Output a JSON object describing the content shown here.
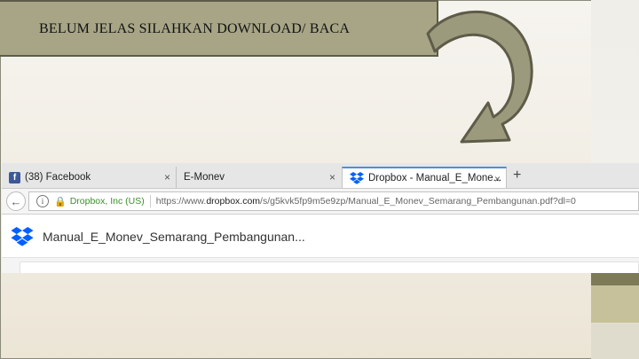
{
  "slide": {
    "title": "BELUM JELAS SILAHKAN DOWNLOAD/ BACA"
  },
  "browser": {
    "tabs": [
      {
        "label": "(38) Facebook",
        "icon": "facebook-icon"
      },
      {
        "label": "E-Monev",
        "icon": ""
      },
      {
        "label": "Dropbox - Manual_E_Mone...",
        "icon": "dropbox-icon",
        "active": true
      }
    ],
    "new_tab": "+",
    "close_glyph": "×",
    "address": {
      "identity": "Dropbox, Inc (US)",
      "url_prefix": "https://www.",
      "url_domain": "dropbox.com",
      "url_path": "/s/g5kvk5fp9m5e9zp/Manual_E_Monev_Semarang_Pembangunan.pdf?dl=0"
    }
  },
  "dropbox": {
    "filename": "Manual_E_Monev_Semarang_Pembangunan..."
  },
  "colors": {
    "title_box": "#a7a586",
    "arrow_fill": "#9c9a7c",
    "dropbox_blue": "#0061fe",
    "secure_green": "#3a8f2a"
  }
}
